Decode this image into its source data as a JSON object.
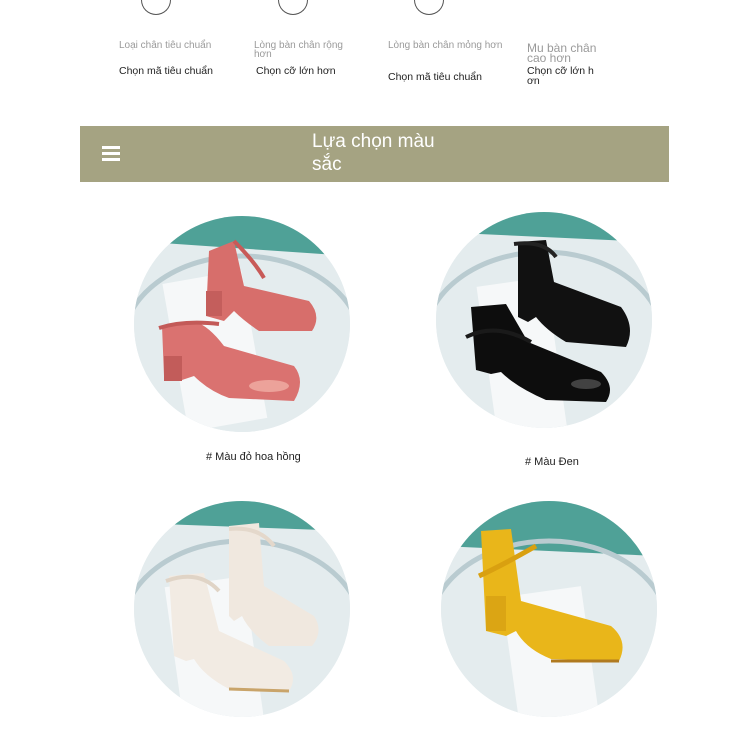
{
  "foot_types": [
    {
      "type": "Loại chân tiêu chuẩn",
      "size": "Chọn mã tiêu chuẩn"
    },
    {
      "type": "Lòng bàn chân rộng hơn",
      "size": "Chọn cỡ lớn hơn"
    },
    {
      "type": "Lòng bàn chân mỏng hơn",
      "size": "Chọn mã tiêu chuẩn"
    },
    {
      "type": "Mu bàn chân cao hơn",
      "size": "Chọn cỡ lớn hơn"
    }
  ],
  "banner": {
    "title": "Lựa chọn màu sắc",
    "icon": "menu-icon",
    "color": "#a5a382"
  },
  "colors": [
    {
      "label": "# Màu đỏ hoa hồng",
      "shoe_color": "#d96a6a"
    },
    {
      "label": "# Màu Đen",
      "shoe_color": "#111111"
    },
    {
      "label": "",
      "shoe_color": "#efe6dc"
    },
    {
      "label": "",
      "shoe_color": "#e6b81c"
    }
  ]
}
